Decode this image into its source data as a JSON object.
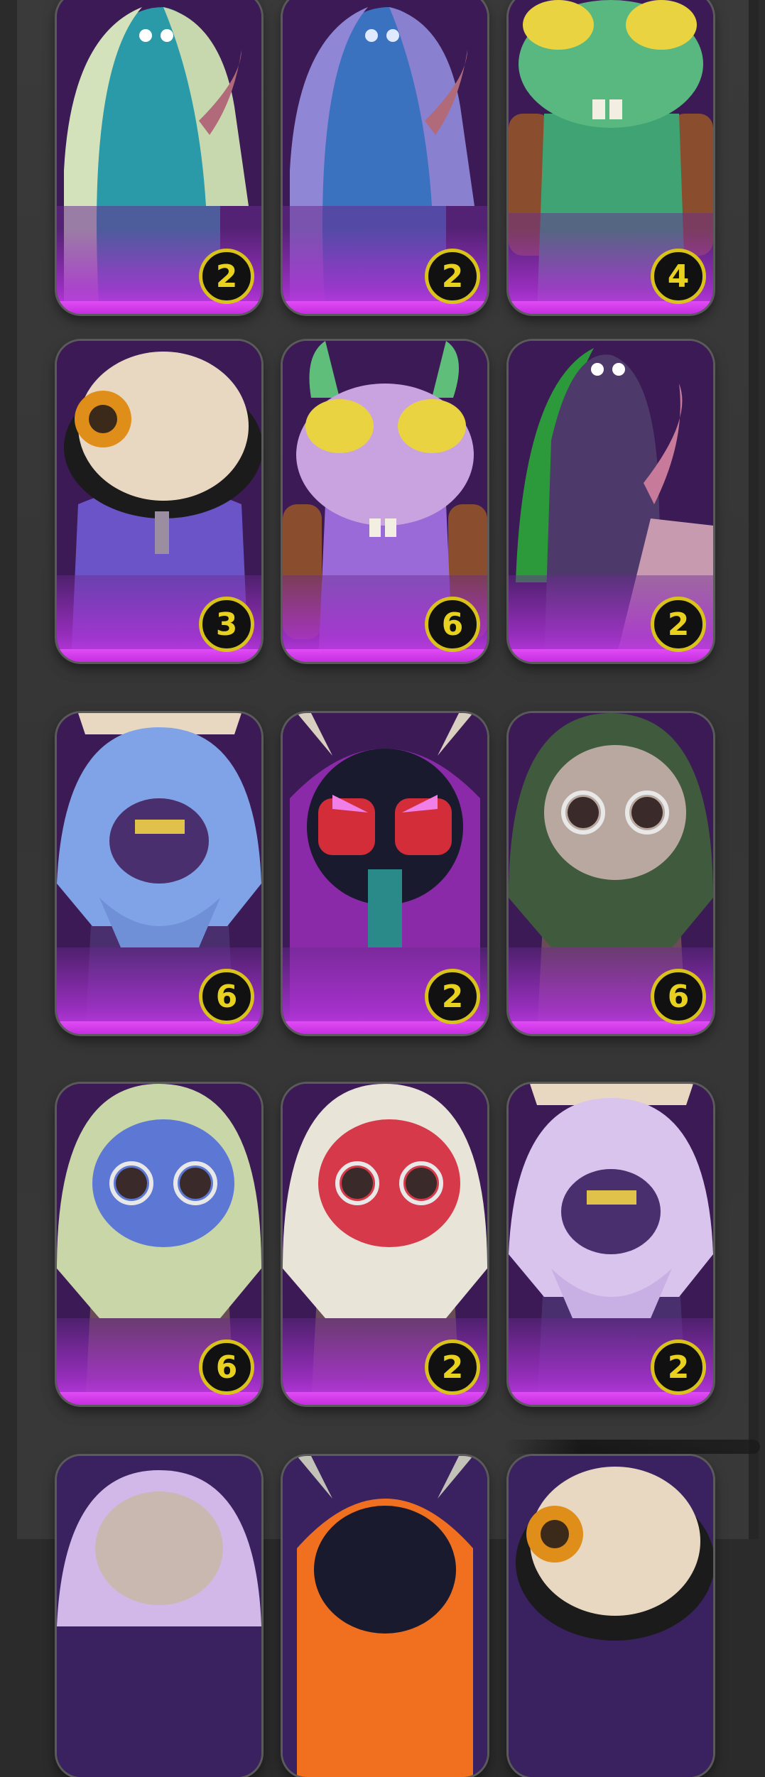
{
  "cards": [
    {
      "name": "card-ghost-white",
      "count": "2",
      "palette": [
        "#c9d9b0",
        "#3aa3b0",
        "#5b2a8a"
      ]
    },
    {
      "name": "card-ghost-lavender",
      "count": "2",
      "palette": [
        "#8f86d6",
        "#3b74c0",
        "#4a2a88"
      ]
    },
    {
      "name": "card-frog-green",
      "count": "4",
      "palette": [
        "#58b880",
        "#e9d341",
        "#a8673a"
      ]
    },
    {
      "name": "card-mummy-purple",
      "count": "3",
      "palette": [
        "#e8d8c2",
        "#6a54c8",
        "#1b1b1b"
      ]
    },
    {
      "name": "card-frog-purple",
      "count": "6",
      "palette": [
        "#c9a3e0",
        "#e9d341",
        "#7e4fd0"
      ]
    },
    {
      "name": "card-ghost-dark",
      "count": "2",
      "palette": [
        "#4e3a6a",
        "#2c9a3b",
        "#c87a9a"
      ]
    },
    {
      "name": "card-troll-blue",
      "count": "6",
      "palette": [
        "#7fa3e6",
        "#4a2f6e",
        "#e0c14a"
      ]
    },
    {
      "name": "card-hood-magenta",
      "count": "2",
      "palette": [
        "#9b2fb8",
        "#d42d3a",
        "#1a1a2e"
      ]
    },
    {
      "name": "card-mask-gray",
      "count": "6",
      "palette": [
        "#b8a8a0",
        "#3f5a3c",
        "#6a4c58"
      ]
    },
    {
      "name": "card-mask-blue",
      "count": "6",
      "palette": [
        "#5d78d4",
        "#c9d6a8",
        "#6a4c58"
      ]
    },
    {
      "name": "card-mask-red",
      "count": "2",
      "palette": [
        "#d63a4a",
        "#e8e4d8",
        "#6a4c58"
      ]
    },
    {
      "name": "card-troll-lilac",
      "count": "2",
      "palette": [
        "#d8c4ec",
        "#4a2f6e",
        "#e0c14a"
      ]
    },
    {
      "name": "card-partial-1",
      "count": "",
      "palette": [
        "#d2b8e8",
        "#3a2260",
        "#3a2260"
      ]
    },
    {
      "name": "card-partial-2",
      "count": "",
      "palette": [
        "#f07020",
        "#c2c2b8",
        "#3a2260"
      ]
    },
    {
      "name": "card-partial-3",
      "count": "",
      "palette": [
        "#e8d8c2",
        "#3a2260",
        "#1b1b1b"
      ]
    }
  ]
}
